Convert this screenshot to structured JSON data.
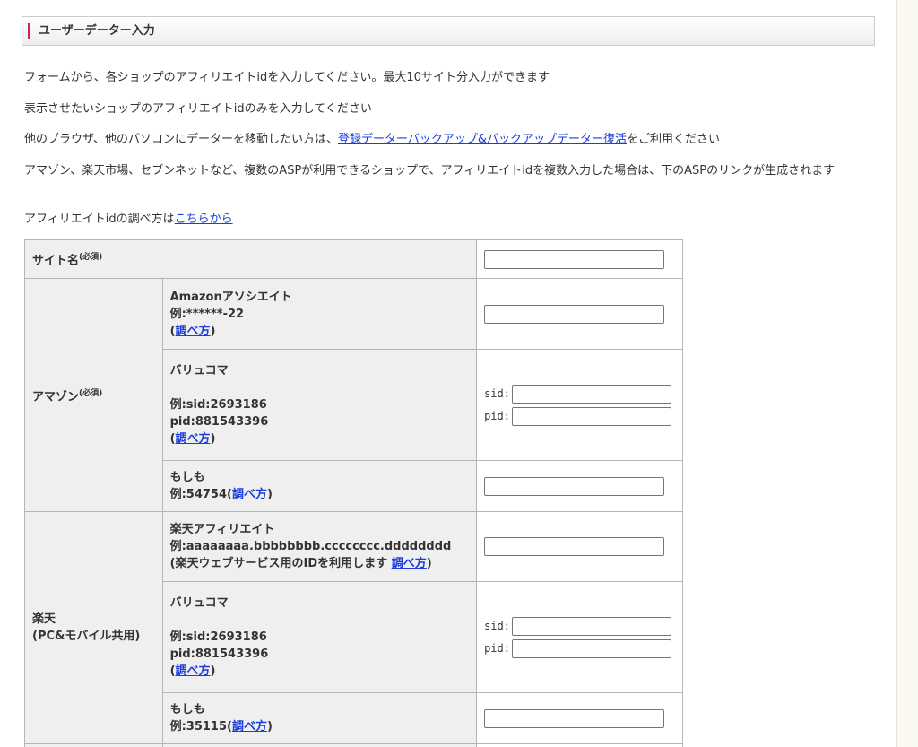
{
  "header": {
    "title": "ユーザーデーター入力"
  },
  "intro": {
    "p1": "フォームから、各ショップのアフィリエイトidを入力してください。最大10サイト分入力ができます",
    "p2": "表示させたいショップのアフィリエイトidのみを入力してください",
    "p3_pre": "他のブラウザ、他のパソコンにデーターを移動したい方は、",
    "p3_link": "登録データーバックアップ&バックアップデーター復活",
    "p3_post": "をご利用ください",
    "p4": "アマゾン、楽天市場、セブンネットなど、複数のASPが利用できるショップで、アフィリエイトidを複数入力した場合は、下のASPのリンクが生成されます",
    "p5_pre": "アフィリエイトidの調べ方は",
    "p5_link": "こちらから"
  },
  "form": {
    "site_name": {
      "label": "サイト名",
      "required": "(必須)",
      "value": ""
    },
    "amazon": {
      "label": "アマゾン",
      "required": "(必須)",
      "associate": {
        "name": "Amazonアソシエイト",
        "example": "例:******-22",
        "howto_open": "(",
        "howto": "調べ方",
        "howto_close": ")",
        "value": ""
      },
      "valuecommerce": {
        "name": "バリュコマ",
        "example_sid": "例:sid:2693186",
        "example_pid": "pid:881543396",
        "howto_open": "(",
        "howto": "調べ方",
        "howto_close": ")",
        "sid_label": "sid:",
        "pid_label": "pid:",
        "sid_value": "",
        "pid_value": ""
      },
      "moshimo": {
        "name": "もしも",
        "example": "例:54754(",
        "howto": "調べ方",
        "howto_close": ")",
        "value": ""
      }
    },
    "rakuten": {
      "label_line1": "楽天",
      "label_line2": "(PC&モバイル共用)",
      "affiliate": {
        "name": "楽天アフィリエイト",
        "example": "例:aaaaaaaa.bbbbbbbb.cccccccc.dddddddd",
        "note": "(楽天ウェブサービス用のIDを利用します ",
        "howto": "調べ方",
        "howto_close": ")",
        "value": ""
      },
      "valuecommerce": {
        "name": "バリュコマ",
        "example_sid": "例:sid:2693186",
        "example_pid": "pid:881543396",
        "howto_open": "(",
        "howto": "調べ方",
        "howto_close": ")",
        "sid_label": "sid:",
        "pid_label": "pid:",
        "sid_value": "",
        "pid_value": ""
      },
      "moshimo": {
        "name": "もしも",
        "example": "例:35115(",
        "howto": "調べ方",
        "howto_close": ")",
        "value": ""
      }
    }
  }
}
